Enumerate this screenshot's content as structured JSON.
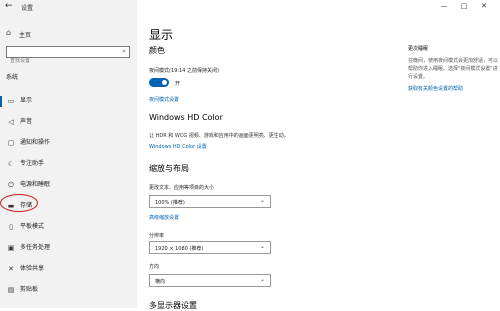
{
  "window": {
    "title": "设置",
    "controls": [
      "—",
      "□",
      "✕"
    ]
  },
  "sidebar": {
    "home_label": "主页",
    "search_placeholder": "查找设置",
    "section": "系统",
    "items": [
      {
        "label": "显示",
        "icon": "monitor-icon"
      },
      {
        "label": "声音",
        "icon": "speaker-icon"
      },
      {
        "label": "通知和操作",
        "icon": "notification-icon"
      },
      {
        "label": "专注助手",
        "icon": "moon-icon"
      },
      {
        "label": "电源和睡眠",
        "icon": "power-icon"
      },
      {
        "label": "存储",
        "icon": "storage-icon"
      },
      {
        "label": "平板模式",
        "icon": "tablet-icon"
      },
      {
        "label": "多任务处理",
        "icon": "multitask-icon"
      },
      {
        "label": "体验共享",
        "icon": "share-icon"
      },
      {
        "label": "剪贴板",
        "icon": "clipboard-icon"
      }
    ]
  },
  "main": {
    "title": "显示",
    "color_heading": "颜色",
    "night_light_label": "夜间模式(19:14 之前保持关闭)",
    "night_light_state": "开",
    "night_light_link": "夜间模式设置",
    "hdr_heading": "Windows HD Color",
    "hdr_desc": "让 HDR 和 WCG 视频、游戏和应用中的画面更明亮、更生动。",
    "hdr_link": "Windows HD Color 设置",
    "scale_heading": "缩放与布局",
    "scale_label": "更改文本、应用等项目的大小",
    "scale_value": "100% (推荐)",
    "advanced_link": "高级缩放设置",
    "resolution_label": "分辨率",
    "resolution_value": "1920 × 1080 (推荐)",
    "orientation_label": "方向",
    "orientation_value": "横向",
    "multi_heading": "多显示器设置"
  },
  "side_panel": {
    "title": "更次睡眠",
    "desc": "在晚间，使用夜间模式会更加舒适，可以帮助你进入睡眠。选择\"夜间模式设置\"进行设置。",
    "link": "获取有关颜色设置的帮助"
  },
  "colors": {
    "accent": "#0063b1",
    "highlight_circle": "#d11a1a"
  }
}
